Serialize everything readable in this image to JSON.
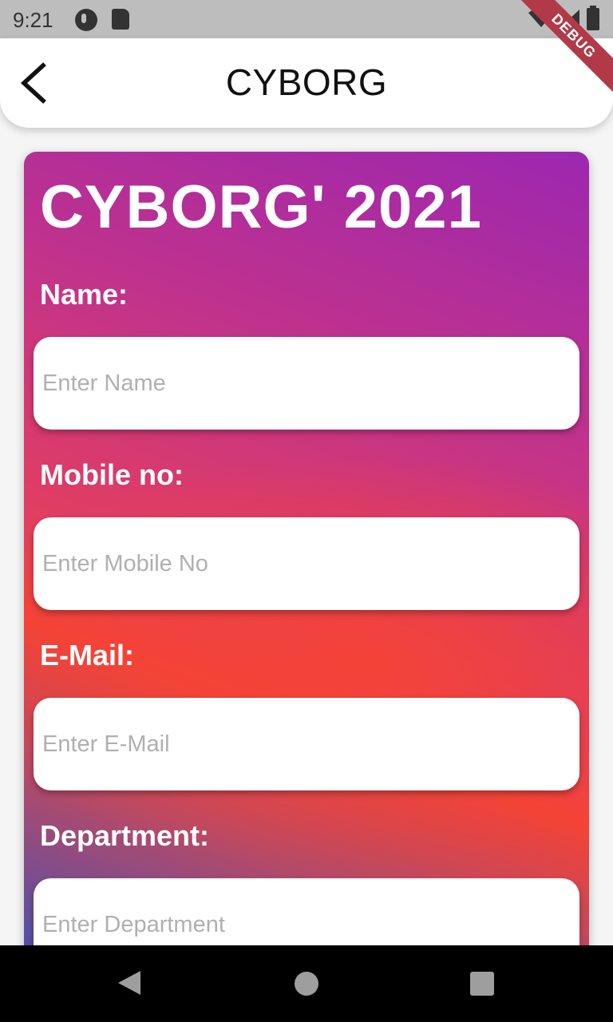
{
  "status_bar": {
    "time": "9:21",
    "icons": [
      "notification-app-icon",
      "sd-card-icon",
      "wifi-icon",
      "signal-icon",
      "battery-icon"
    ]
  },
  "debug_banner": "DEBUG",
  "app_bar": {
    "title": "CYBORG",
    "back_icon": "chevron-left-icon"
  },
  "form": {
    "title": "CYBORG' 2021",
    "fields": [
      {
        "label": "Name:",
        "placeholder": "Enter Name",
        "value": ""
      },
      {
        "label": "Mobile no:",
        "placeholder": "Enter Mobile No",
        "value": ""
      },
      {
        "label": "E-Mail:",
        "placeholder": "Enter E-Mail",
        "value": ""
      },
      {
        "label": "Department:",
        "placeholder": "Enter Department",
        "value": ""
      }
    ]
  },
  "nav_bar": {
    "icons": [
      "back-triangle-icon",
      "home-circle-icon",
      "recents-square-icon"
    ]
  },
  "colors": {
    "gradient_purple": "#9c27b0",
    "gradient_red": "#f44336",
    "gradient_blue": "#3f51b5",
    "debug_ribbon": "#b23a48"
  }
}
